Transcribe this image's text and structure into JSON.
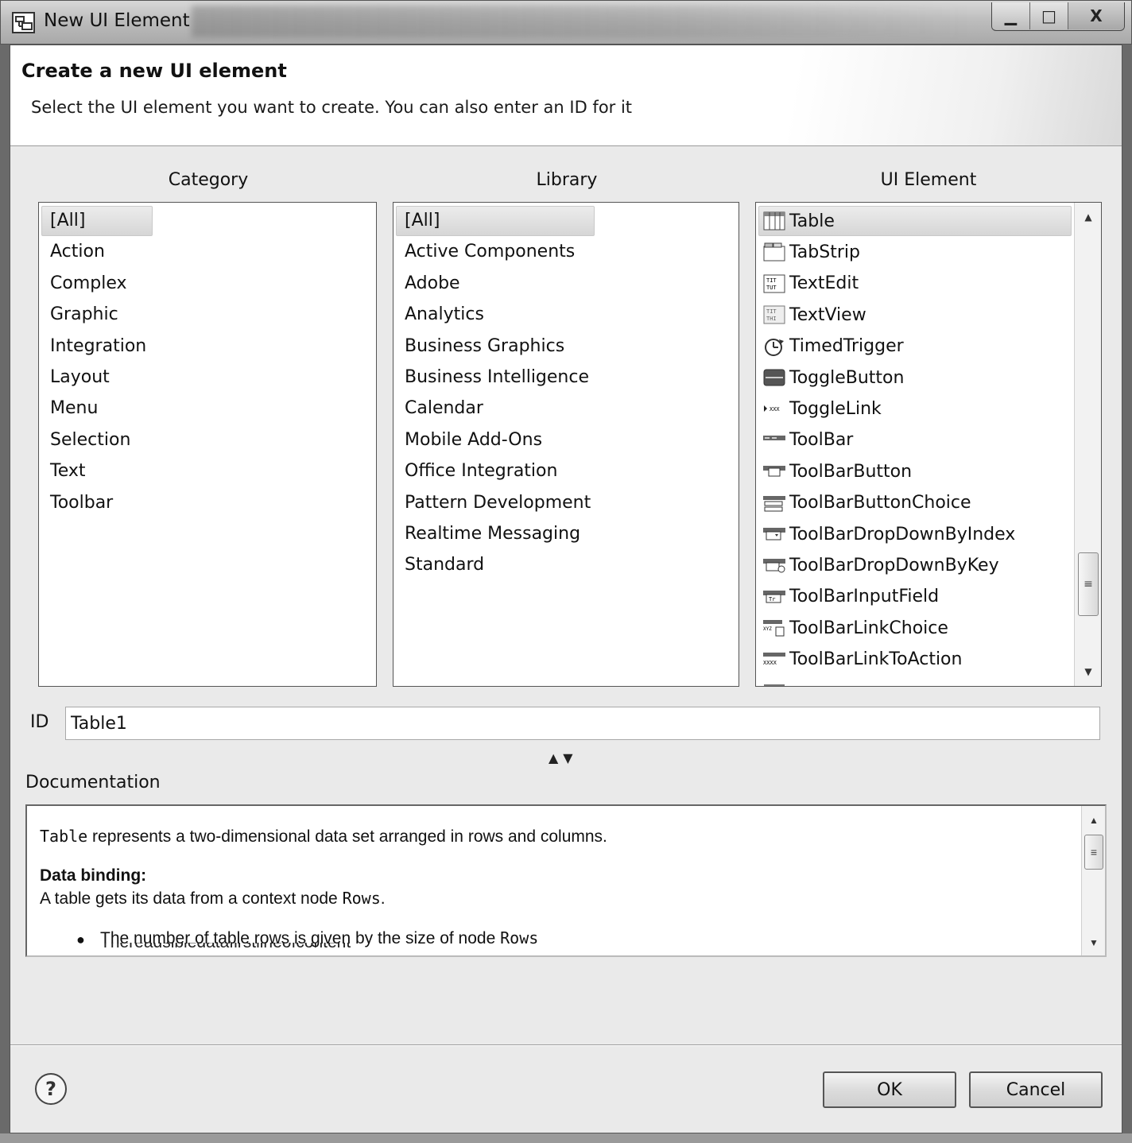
{
  "window": {
    "title": "New UI Element",
    "minimize": "▁",
    "maximize": "□",
    "close": "X"
  },
  "header": {
    "title": "Create a new UI element",
    "subtitle": "Select the UI element you want to create. You can also enter an ID for it"
  },
  "category": {
    "heading": "Category",
    "selected": "[All]",
    "items": [
      "[All]",
      "Action",
      "Complex",
      "Graphic",
      "Integration",
      "Layout",
      "Menu",
      "Selection",
      "Text",
      "Toolbar"
    ]
  },
  "library": {
    "heading": "Library",
    "selected": "[All]",
    "items": [
      "[All]",
      "Active Components",
      "Adobe",
      "Analytics",
      "Business Graphics",
      "Business Intelligence",
      "Calendar",
      "Mobile Add-Ons",
      "Office Integration",
      "Pattern Development",
      "Realtime Messaging",
      "Standard"
    ]
  },
  "ui_element": {
    "heading": "UI Element",
    "selected": "Table",
    "items": [
      {
        "label": "Table",
        "icon": "table-icon"
      },
      {
        "label": "TabStrip",
        "icon": "tabstrip-icon"
      },
      {
        "label": "TextEdit",
        "icon": "textedit-icon"
      },
      {
        "label": "TextView",
        "icon": "textview-icon"
      },
      {
        "label": "TimedTrigger",
        "icon": "timer-icon"
      },
      {
        "label": "ToggleButton",
        "icon": "toggle-button-icon"
      },
      {
        "label": "ToggleLink",
        "icon": "toggle-link-icon"
      },
      {
        "label": "ToolBar",
        "icon": "toolbar-icon"
      },
      {
        "label": "ToolBarButton",
        "icon": "toolbar-button-icon"
      },
      {
        "label": "ToolBarButtonChoice",
        "icon": "toolbar-button-choice-icon"
      },
      {
        "label": "ToolBarDropDownByIndex",
        "icon": "toolbar-dropdown-index-icon"
      },
      {
        "label": "ToolBarDropDownByKey",
        "icon": "toolbar-dropdown-key-icon"
      },
      {
        "label": "ToolBarInputField",
        "icon": "toolbar-input-field-icon"
      },
      {
        "label": "ToolBarLinkChoice",
        "icon": "toolbar-link-choice-icon"
      },
      {
        "label": "ToolBarLinkToAction",
        "icon": "toolbar-link-action-icon"
      }
    ]
  },
  "id_field": {
    "label": "ID",
    "value": "Table1"
  },
  "documentation": {
    "label": "Documentation",
    "intro_code": "Table",
    "intro_text": " represents a two-dimensional data set arranged in rows and columns.",
    "data_binding_heading": "Data binding:",
    "binding_text": "A table gets its data from a context node ",
    "binding_code": "Rows",
    "binding_end": ".",
    "bullet_text": "The number of table rows is given by the size of node ",
    "bullet_code": "Rows"
  },
  "buttons": {
    "ok": "OK",
    "cancel": "Cancel",
    "help": "?"
  },
  "colors": {
    "dialog_bg": "#eaeaea",
    "selection_bg": "#d6d6d6",
    "list_bg": "#ffffff"
  }
}
